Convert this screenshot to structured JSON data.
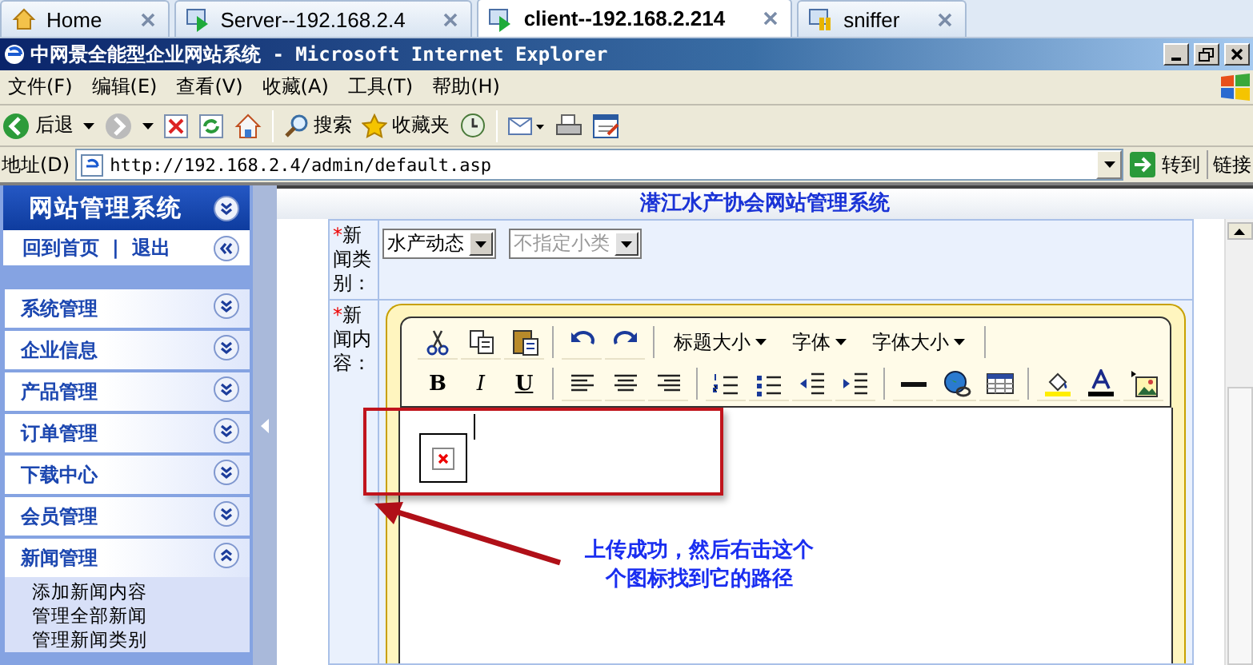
{
  "browser_tabs": [
    {
      "label": "Home",
      "kind": "home",
      "selected": false
    },
    {
      "label": "Server--192.168.2.4",
      "kind": "vm",
      "selected": false
    },
    {
      "label": "client--192.168.2.214",
      "kind": "vm",
      "selected": true
    },
    {
      "label": "sniffer",
      "kind": "vm-paused",
      "selected": false
    }
  ],
  "window": {
    "title": "中网景全能型企业网站系统 - Microsoft Internet Explorer"
  },
  "menu": [
    "文件(F)",
    "编辑(E)",
    "查看(V)",
    "收藏(A)",
    "工具(T)",
    "帮助(H)"
  ],
  "toolbar": [
    {
      "kind": "back",
      "label": "后退"
    },
    {
      "kind": "forward"
    },
    {
      "kind": "stop"
    },
    {
      "kind": "refresh"
    },
    {
      "kind": "home"
    },
    {
      "kind": "search",
      "label": "搜索"
    },
    {
      "kind": "favorites",
      "label": "收藏夹"
    },
    {
      "kind": "history"
    },
    {
      "kind": "mail"
    },
    {
      "kind": "print"
    },
    {
      "kind": "edit"
    }
  ],
  "address": {
    "label": "地址(D)",
    "value": "http://192.168.2.4/admin/default.asp",
    "go": "转到",
    "links": "链接"
  },
  "sidebar": {
    "title": "网站管理系统",
    "home": "回到首页",
    "separator": "|",
    "logout": "退出",
    "sections": [
      {
        "label": "系统管理",
        "expanded": false
      },
      {
        "label": "企业信息",
        "expanded": false
      },
      {
        "label": "产品管理",
        "expanded": false
      },
      {
        "label": "订单管理",
        "expanded": false
      },
      {
        "label": "下载中心",
        "expanded": false
      },
      {
        "label": "会员管理",
        "expanded": false
      },
      {
        "label": "新闻管理",
        "expanded": true,
        "children": [
          "添加新闻内容",
          "管理全部新闻",
          "管理新闻类别"
        ]
      }
    ]
  },
  "main": {
    "title": "潜江水产协会网站管理系统",
    "category": {
      "mark": "*",
      "label": "新闻类别：",
      "select": "水产动态",
      "subselect": {
        "value": "不指定小类",
        "disabled": true
      }
    },
    "content": {
      "mark": "*",
      "label": "新闻内容："
    },
    "editor": {
      "rows": [
        [
          {
            "kind": "cut"
          },
          {
            "kind": "copy"
          },
          {
            "kind": "paste"
          },
          {
            "kind": "sep"
          },
          {
            "kind": "undo"
          },
          {
            "kind": "redo"
          },
          {
            "kind": "sep"
          },
          {
            "kind": "dropdown",
            "label": "标题大小"
          },
          {
            "kind": "dropdown",
            "label": "字体"
          },
          {
            "kind": "dropdown",
            "label": "字体大小"
          },
          {
            "kind": "sep"
          }
        ],
        [
          {
            "kind": "bold",
            "label": "B"
          },
          {
            "kind": "italic",
            "label": "I"
          },
          {
            "kind": "underline",
            "label": "U"
          },
          {
            "kind": "sep"
          },
          {
            "kind": "align-left"
          },
          {
            "kind": "align-center"
          },
          {
            "kind": "align-right"
          },
          {
            "kind": "sep"
          },
          {
            "kind": "ordered-list"
          },
          {
            "kind": "bullet-list"
          },
          {
            "kind": "outdent"
          },
          {
            "kind": "indent"
          },
          {
            "kind": "sep"
          },
          {
            "kind": "rule"
          },
          {
            "kind": "link"
          },
          {
            "kind": "table"
          },
          {
            "kind": "sep"
          },
          {
            "kind": "highlight"
          },
          {
            "kind": "font-color"
          },
          {
            "kind": "image"
          }
        ]
      ]
    }
  },
  "annotation": {
    "lines": [
      "上传成功，然后右击这个",
      "个图标找到它的路径"
    ]
  }
}
